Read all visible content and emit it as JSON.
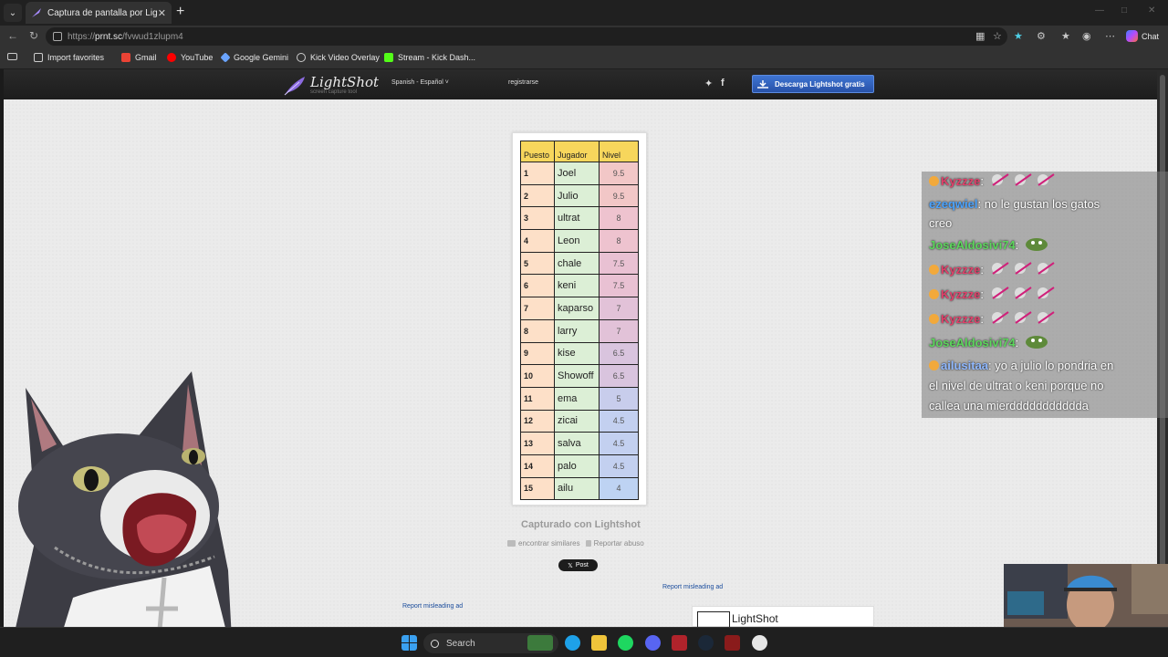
{
  "browser": {
    "tab_title": "Captura de pantalla por Lightshot",
    "url_prefix": "https://",
    "url_host": "prnt.sc",
    "url_path": "/fvwud1zlupm4",
    "chat_label": "Chat"
  },
  "bookmarks": [
    {
      "label": "Import favorites",
      "icon": "folder-icon"
    },
    {
      "label": "Gmail",
      "icon": "gmail-icon"
    },
    {
      "label": "YouTube",
      "icon": "youtube-icon"
    },
    {
      "label": "Google Gemini",
      "icon": "gemini-icon"
    },
    {
      "label": "Kick Video Overlay",
      "icon": "globe-icon"
    },
    {
      "label": "Stream - Kick Dash...",
      "icon": "kick-icon"
    }
  ],
  "lightshot": {
    "logo_name": "LightShot",
    "logo_tagline": "screen capture tool",
    "language": "Spanish - Español",
    "register": "registrarse",
    "download_label": "Descarga Lightshot gratis",
    "captured_label": "Capturado con Lightshot",
    "find_similar": "encontrar similares",
    "report_abuse": "Reportar abuso",
    "post_label": "Post",
    "report_ad": "Report misleading ad",
    "ad_name": "LightShot"
  },
  "table": {
    "headers": [
      "Puesto",
      "Jugador",
      "Nivel"
    ],
    "rows": [
      {
        "pos": "1",
        "name": "Joel",
        "level": "9.5",
        "color": "#f2c7c7"
      },
      {
        "pos": "2",
        "name": "Julio",
        "level": "9.5",
        "color": "#f2c7c7"
      },
      {
        "pos": "3",
        "name": "ultrat",
        "level": "8",
        "color": "#eec3cf"
      },
      {
        "pos": "4",
        "name": "Leon",
        "level": "8",
        "color": "#eec3cf"
      },
      {
        "pos": "5",
        "name": "chale",
        "level": "7.5",
        "color": "#e9c1d3"
      },
      {
        "pos": "6",
        "name": "keni",
        "level": "7.5",
        "color": "#e9c1d3"
      },
      {
        "pos": "7",
        "name": "kaparso",
        "level": "7",
        "color": "#e2c2d8"
      },
      {
        "pos": "8",
        "name": "larry",
        "level": "7",
        "color": "#e2c2d8"
      },
      {
        "pos": "9",
        "name": "kise",
        "level": "6.5",
        "color": "#d9c4de"
      },
      {
        "pos": "10",
        "name": "Showoff",
        "level": "6.5",
        "color": "#d9c4de"
      },
      {
        "pos": "11",
        "name": "ema",
        "level": "5",
        "color": "#c8cdec"
      },
      {
        "pos": "12",
        "name": "zicai",
        "level": "4.5",
        "color": "#c3d0f0"
      },
      {
        "pos": "13",
        "name": "salva",
        "level": "4.5",
        "color": "#c3d0f0"
      },
      {
        "pos": "14",
        "name": "palo",
        "level": "4.5",
        "color": "#c3d0f0"
      },
      {
        "pos": "15",
        "name": "ailu",
        "level": "4",
        "color": "#bed3f3"
      }
    ]
  },
  "chat": [
    {
      "user": "Kyzzze",
      "color": "#e0406a",
      "text": "",
      "emotes": 3
    },
    {
      "user": "ezeqwiel",
      "color": "#4aa3ff",
      "text": "no le gustan los gatos",
      "emotes": 0
    },
    {
      "user": "",
      "color": "#ffffff",
      "text": "creo",
      "emotes": 0
    },
    {
      "user": "JoseAldosivi74",
      "color": "#5cd65c",
      "text": "",
      "emotes": 1
    },
    {
      "user": "Kyzzze",
      "color": "#e0406a",
      "text": "",
      "emotes": 3
    },
    {
      "user": "Kyzzze",
      "color": "#e0406a",
      "text": "",
      "emotes": 3
    },
    {
      "user": "Kyzzze",
      "color": "#e0406a",
      "text": "",
      "emotes": 3
    },
    {
      "user": "JoseAldosivi74",
      "color": "#5cd65c",
      "text": "",
      "emotes": 1
    },
    {
      "user": "ailusitaa",
      "color": "#8fb8ff",
      "text": "yo a julio lo pondria en",
      "emotes": 0
    },
    {
      "user": "",
      "color": "#ffffff",
      "text": "el nivel de ultrat o keni porque no",
      "emotes": 0
    },
    {
      "user": "",
      "color": "#ffffff",
      "text": "callea una mierddddddddddda",
      "emotes": 0
    }
  ],
  "taskbar": {
    "search_label": "Search"
  }
}
